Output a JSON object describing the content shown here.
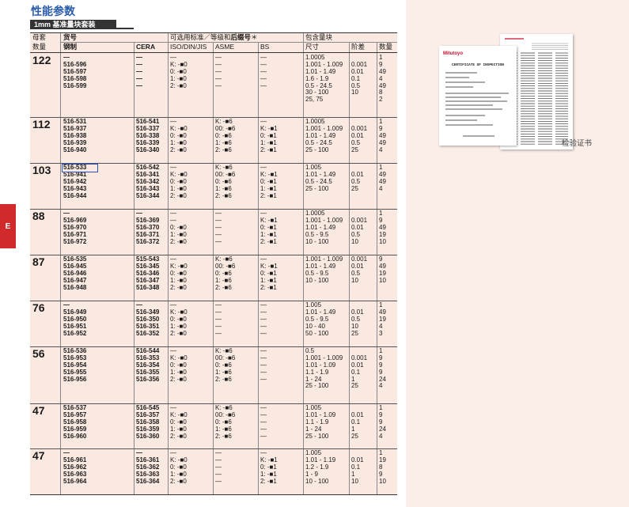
{
  "title": "性能参数",
  "subtitle": "1mm 基准量块套装",
  "side_tab": "E",
  "headers": {
    "mother": "母套",
    "qty": "数量",
    "part_no": "货号",
    "steel": "钢制",
    "cera": "CERA",
    "grade_title_prefix": "可选用标准／等级和",
    "grade_title_bold": "后缀号",
    "grade_title_suffix": "＊",
    "iso": "ISO/DIN/JIS",
    "asme": "ASME",
    "bs": "BS",
    "included": "包含量块",
    "size": "尺寸",
    "step": "阶差",
    "count": "数量"
  },
  "groups": [
    {
      "num": "122",
      "steel": [
        "—",
        "516-596",
        "516-597",
        "516-598",
        "516-599",
        "",
        ""
      ],
      "cera": [
        "—",
        "—",
        "—",
        "—",
        "—",
        "",
        ""
      ],
      "iso": [
        "—",
        "K: -■0",
        "0: -■0",
        "1: -■0",
        "2: -■0",
        "",
        ""
      ],
      "asme": [
        "—",
        "—",
        "—",
        "—",
        "—",
        "",
        ""
      ],
      "bs": [
        "—",
        "—",
        "—",
        "—",
        "—",
        "",
        ""
      ],
      "size": [
        "1.0005",
        "1.001 - 1.009",
        "1.01 - 1.49",
        "1.6 - 1.9",
        "0.5 - 24.5",
        "30 - 100",
        "25, 75"
      ],
      "step": [
        "",
        "0.001",
        "0.01",
        "0.1",
        "0.5",
        "10",
        ""
      ],
      "count": [
        "1",
        "9",
        "49",
        "4",
        "49",
        "8",
        "2"
      ]
    },
    {
      "num": "112",
      "steel": [
        "516-531",
        "516-937",
        "516-938",
        "516-939",
        "516-940"
      ],
      "cera": [
        "516-541",
        "516-337",
        "516-338",
        "516-339",
        "516-340"
      ],
      "iso": [
        "—",
        "K: -■0",
        "0: -■0",
        "1: -■0",
        "2: -■0"
      ],
      "asme": [
        "K: -■6",
        "00: -■6",
        "0: -■6",
        "1: -■6",
        "2: -■6"
      ],
      "bs": [
        "—",
        "K: -■1",
        "0: -■1",
        "1: -■1",
        "2: -■1"
      ],
      "size": [
        "1.0005",
        "1.001 - 1.009",
        "1.01 - 1.49",
        "0.5 - 24.5",
        "25 - 100"
      ],
      "step": [
        "",
        "0.001",
        "0.01",
        "0.5",
        "25"
      ],
      "count": [
        "1",
        "9",
        "49",
        "49",
        "4"
      ]
    },
    {
      "num": "103",
      "steel": [
        "516-533",
        "516-941",
        "516-942",
        "516-943",
        "516-944"
      ],
      "cera": [
        "516-542",
        "516-341",
        "516-342",
        "516-343",
        "516-344"
      ],
      "iso": [
        "—",
        "K: -■0",
        "0: -■0",
        "1: -■0",
        "2: -■0"
      ],
      "asme": [
        "K: -■6",
        "00: -■6",
        "0: -■6",
        "1: -■6",
        "2: -■6"
      ],
      "bs": [
        "—",
        "K: -■1",
        "0: -■1",
        "1: -■1",
        "2: -■1"
      ],
      "size": [
        "1.005",
        "1.01 - 1.49",
        "0.5 - 24.5",
        "25 - 100",
        ""
      ],
      "step": [
        "",
        "0.01",
        "0.5",
        "25",
        ""
      ],
      "count": [
        "1",
        "49",
        "49",
        "4",
        ""
      ]
    },
    {
      "num": "88",
      "steel": [
        "—",
        "516-969",
        "516-970",
        "516-971",
        "516-972"
      ],
      "cera": [
        "—",
        "516-369",
        "516-370",
        "516-371",
        "516-372"
      ],
      "iso": [
        "—",
        "—",
        "0: -■0",
        "1: -■0",
        "2: -■0"
      ],
      "asme": [
        "—",
        "—",
        "—",
        "—",
        "—"
      ],
      "bs": [
        "—",
        "K: -■1",
        "0: -■1",
        "1: -■1",
        "2: -■1"
      ],
      "size": [
        "1.0005",
        "1.001 - 1.009",
        "1.01 - 1.49",
        "0.5 - 9.5",
        "10 - 100"
      ],
      "step": [
        "",
        "0.001",
        "0.01",
        "0.5",
        "10"
      ],
      "count": [
        "1",
        "9",
        "49",
        "19",
        "10"
      ]
    },
    {
      "num": "87",
      "steel": [
        "516-535",
        "516-945",
        "516-946",
        "516-947",
        "516-948"
      ],
      "cera": [
        "515-543",
        "516-345",
        "516-346",
        "516-347",
        "516-348"
      ],
      "iso": [
        "—",
        "K: -■0",
        "0: -■0",
        "1: -■0",
        "2: -■0"
      ],
      "asme": [
        "K: -■6",
        "00: -■6",
        "0: -■6",
        "1: -■6",
        "2: -■6"
      ],
      "bs": [
        "—",
        "K: -■1",
        "0: -■1",
        "1: -■1",
        "2: -■1"
      ],
      "size": [
        "1.001 - 1.009",
        "1.01 - 1.49",
        "0.5 - 9.5",
        "10 - 100",
        ""
      ],
      "step": [
        "0.001",
        "0.01",
        "0.5",
        "10",
        ""
      ],
      "count": [
        "9",
        "49",
        "19",
        "10",
        ""
      ]
    },
    {
      "num": "76",
      "steel": [
        "—",
        "516-949",
        "516-950",
        "516-951",
        "516-952"
      ],
      "cera": [
        "—",
        "516-349",
        "516-350",
        "516-351",
        "516-352"
      ],
      "iso": [
        "—",
        "K: -■0",
        "0: -■0",
        "1: -■0",
        "2: -■0"
      ],
      "asme": [
        "—",
        "—",
        "—",
        "—",
        "—"
      ],
      "bs": [
        "—",
        "—",
        "—",
        "—",
        "—"
      ],
      "size": [
        "1.005",
        "1.01 - 1.49",
        "0.5 - 9.5",
        "10 - 40",
        "50 - 100"
      ],
      "step": [
        "",
        "0.01",
        "0.5",
        "10",
        "25"
      ],
      "count": [
        "1",
        "49",
        "19",
        "4",
        "3"
      ]
    },
    {
      "num": "56",
      "steel": [
        "516-536",
        "516-953",
        "516-954",
        "516-955",
        "516-956",
        ""
      ],
      "cera": [
        "516-544",
        "516-353",
        "516-354",
        "516-355",
        "516-356",
        ""
      ],
      "iso": [
        "—",
        "K: -■0",
        "0: -■0",
        "1: -■0",
        "2: -■0",
        ""
      ],
      "asme": [
        "K: -■6",
        "00: -■6",
        "0: -■6",
        "1: -■6",
        "2: -■6",
        ""
      ],
      "bs": [
        "—",
        "—",
        "—",
        "—",
        "—",
        ""
      ],
      "size": [
        "0.5",
        "1.001 - 1.009",
        "1.01 - 1.09",
        "1.1 - 1.9",
        "1 - 24",
        "25 - 100"
      ],
      "step": [
        "",
        "0.001",
        "0.01",
        "0.1",
        "1",
        "25"
      ],
      "count": [
        "1",
        "9",
        "9",
        "9",
        "24",
        "4"
      ]
    },
    {
      "num": "47",
      "steel": [
        "516-537",
        "516-957",
        "516-958",
        "516-959",
        "516-960"
      ],
      "cera": [
        "516-545",
        "516-357",
        "516-358",
        "516-359",
        "516-360"
      ],
      "iso": [
        "—",
        "K: -■0",
        "0: -■0",
        "1: -■0",
        "2: -■0"
      ],
      "asme": [
        "K: -■6",
        "00: -■6",
        "0: -■6",
        "1: -■6",
        "2: -■6"
      ],
      "bs": [
        "—",
        "—",
        "—",
        "—",
        "—"
      ],
      "size": [
        "1.005",
        "1.01 - 1.09",
        "1.1 - 1.9",
        "1 - 24",
        "25 - 100"
      ],
      "step": [
        "",
        "0.01",
        "0.1",
        "1",
        "25"
      ],
      "count": [
        "1",
        "9",
        "9",
        "24",
        "4"
      ]
    },
    {
      "num": "47",
      "steel": [
        "—",
        "516-961",
        "516-962",
        "516-963",
        "516-964"
      ],
      "cera": [
        "—",
        "516-361",
        "516-362",
        "516-363",
        "516-364"
      ],
      "iso": [
        "—",
        "K: -■0",
        "0: -■0",
        "1: -■0",
        "2: -■0"
      ],
      "asme": [
        "—",
        "—",
        "—",
        "—",
        "—"
      ],
      "bs": [
        "—",
        "K: -■1",
        "0: -■1",
        "1: -■1",
        "2: -■1"
      ],
      "size": [
        "1.005",
        "1.01 - 1.19",
        "1.2 - 1.9",
        "1 - 9",
        "10 - 100"
      ],
      "step": [
        "",
        "0.01",
        "0.1",
        "1",
        "10"
      ],
      "count": [
        "1",
        "19",
        "8",
        "9",
        "10"
      ]
    }
  ],
  "certificate": {
    "brand": "Mitutoyo",
    "doc_title": "CERTIFICATE OF INSPECTION",
    "caption": "检验证书"
  }
}
